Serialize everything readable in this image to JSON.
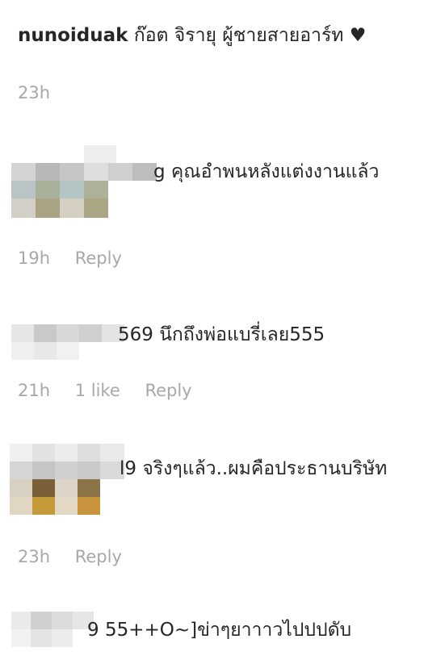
{
  "header_comment": {
    "username": "nunoiduak",
    "text": "ก๊อต จิรายุ ผู้ชายสายอาร์ท ♥",
    "time": "23h"
  },
  "comments": [
    {
      "text": "g คุณอำพนหลังแต่งงานแล้ว",
      "time": "19h",
      "reply_label": "Reply"
    },
    {
      "text": "569 นึกถึงพ่อแบรี่เลย555",
      "time": "21h",
      "likes": "1 like",
      "reply_label": "Reply"
    },
    {
      "text": "l9 จริงๆแล้ว..ผมคือประธานบริษัท",
      "time": "23h",
      "reply_label": "Reply"
    },
    {
      "text": "9 55++O~]ข่าๆยาาาวไปปปดับ"
    }
  ],
  "colors": {
    "text": "#262626",
    "meta": "#a8a8a8",
    "background": "#ffffff"
  }
}
